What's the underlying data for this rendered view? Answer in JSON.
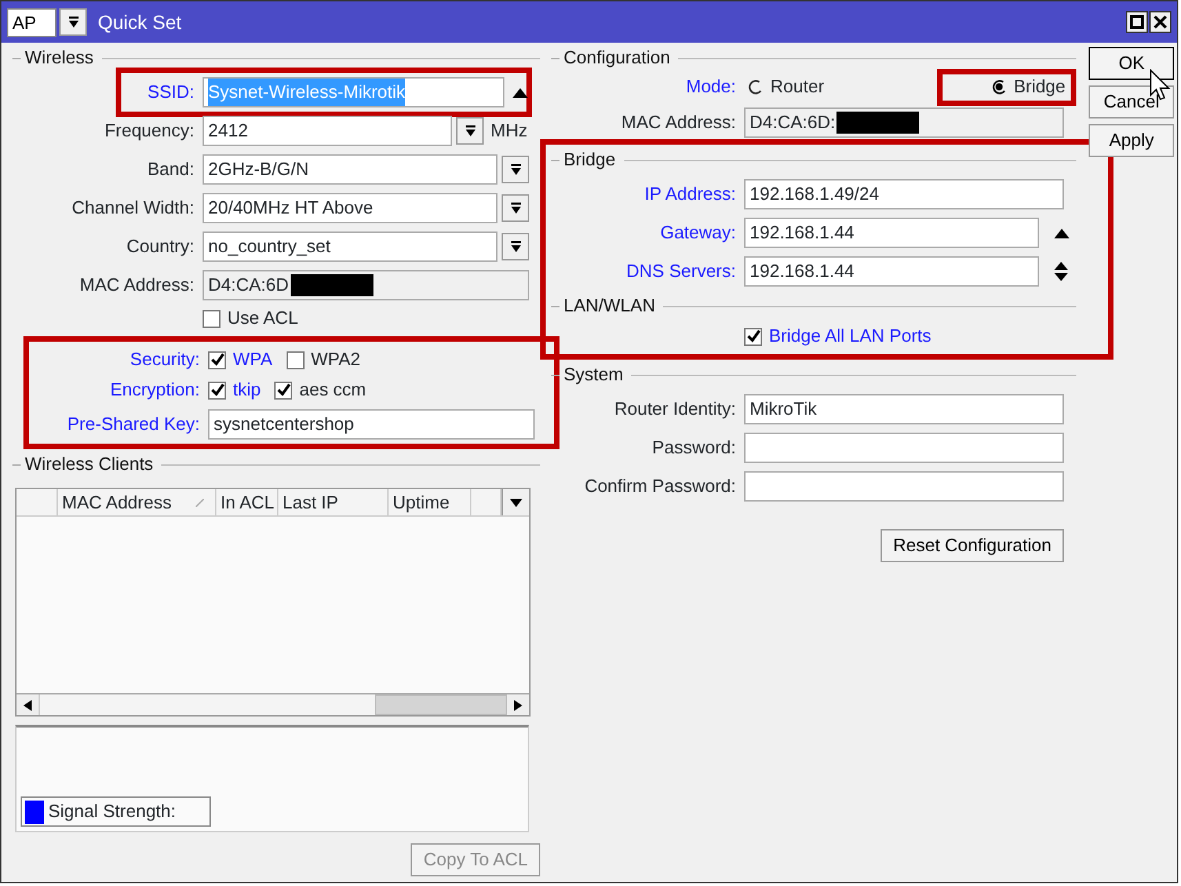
{
  "title_bar": {
    "mode": "AP",
    "title": "Quick Set"
  },
  "wireless": {
    "heading": "Wireless",
    "fields": [
      {
        "label": "SSID:",
        "linked": true,
        "kind": "text",
        "value": "Sysnet-Wireless-Mikrotik",
        "value_selected": true,
        "highlighted": true,
        "spin_up": true,
        "spin_down": false
      },
      {
        "label": "Frequency:",
        "linked": false,
        "kind": "select",
        "value": "2412",
        "unit": "MHz"
      },
      {
        "label": "Band:",
        "linked": false,
        "kind": "select",
        "value": "2GHz-B/G/N"
      },
      {
        "label": "Channel Width:",
        "linked": false,
        "kind": "select",
        "value": "20/40MHz HT Above"
      },
      {
        "label": "Country:",
        "linked": false,
        "kind": "select",
        "value": "no_country_set"
      },
      {
        "label": "MAC Address:",
        "linked": false,
        "kind": "readonly",
        "value": "D4:CA:6D",
        "redacted": true
      }
    ],
    "use_acl": {
      "label": "Use ACL",
      "checked": false
    }
  },
  "security": {
    "highlighted": true,
    "rows": [
      {
        "label": "Security:",
        "linked": true,
        "kind": "checks",
        "options": [
          {
            "label": "WPA",
            "checked": true,
            "linked": true
          },
          {
            "label": "WPA2",
            "checked": false,
            "linked": false
          }
        ]
      },
      {
        "label": "Encryption:",
        "linked": true,
        "kind": "checks",
        "options": [
          {
            "label": "tkip",
            "checked": true,
            "linked": true
          },
          {
            "label": "aes ccm",
            "checked": true,
            "linked": false
          }
        ]
      },
      {
        "label": "Pre-Shared Key:",
        "linked": true,
        "kind": "text",
        "value": "sysnetcentershop"
      }
    ]
  },
  "wireless_clients": {
    "heading": "Wireless Clients",
    "columns": [
      {
        "sorted": false
      },
      {
        "label": "MAC Address",
        "sorted": true
      },
      {
        "label": "In ACL",
        "sorted": false
      },
      {
        "label": "Last IP",
        "sorted": false
      },
      {
        "label": "Uptime",
        "sorted": false
      },
      {
        "sorted": false
      }
    ],
    "legend": {
      "label": "Signal Strength:",
      "color": "#0000ff"
    },
    "copy_button": {
      "label": "Copy To ACL",
      "disabled": true
    }
  },
  "configuration": {
    "heading": "Configuration",
    "mode": {
      "label": "Mode:",
      "linked": true,
      "options": [
        {
          "label": "Router",
          "selected": false,
          "highlighted": false
        },
        {
          "label": "Bridge",
          "selected": true,
          "highlighted": true
        }
      ]
    },
    "mac": {
      "label": "MAC Address:",
      "linked": false,
      "kind": "readonly",
      "value": "D4:CA:6D:",
      "redacted": true
    }
  },
  "bridge": {
    "heading": "Bridge",
    "highlighted": true,
    "fields": [
      {
        "label": "IP Address:",
        "linked": true,
        "kind": "text",
        "value": "192.168.1.49/24"
      },
      {
        "label": "Gateway:",
        "linked": true,
        "kind": "text",
        "value": "192.168.1.44",
        "spin_up": true,
        "spin_down": false
      },
      {
        "label": "DNS Servers:",
        "linked": true,
        "kind": "text",
        "value": "192.168.1.44",
        "spin_up": true,
        "spin_down": true
      }
    ],
    "lan_heading": "LAN/WLAN",
    "bridge_all": {
      "label": "Bridge All LAN Ports",
      "checked": true,
      "linked": true
    }
  },
  "system": {
    "heading": "System",
    "fields": [
      {
        "label": "Router Identity:",
        "linked": false,
        "kind": "text",
        "value": "MikroTik"
      },
      {
        "label": "Password:",
        "linked": false,
        "kind": "text"
      },
      {
        "label": "Confirm Password:",
        "linked": false,
        "kind": "text"
      }
    ],
    "reset_button": "Reset Configuration"
  },
  "buttons": [
    {
      "label": "OK",
      "focused": true
    },
    {
      "label": "Cancel",
      "focused": false
    },
    {
      "label": "Apply",
      "focused": false
    }
  ]
}
